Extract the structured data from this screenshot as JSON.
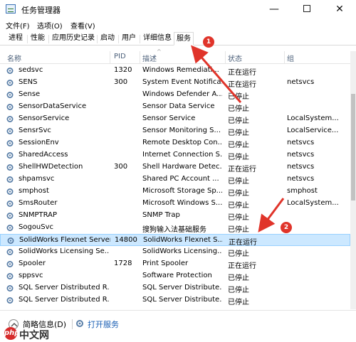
{
  "window": {
    "title": "任务管理器",
    "minimize": "—",
    "close": "✕"
  },
  "menu": [
    "文件(F)",
    "选项(O)",
    "查看(V)"
  ],
  "tabs": [
    "进程",
    "性能",
    "应用历史记录",
    "启动",
    "用户",
    "详细信息",
    "服务"
  ],
  "active_tab_index": 6,
  "columns": {
    "name": "名称",
    "pid": "PID",
    "desc": "描述",
    "status": "状态",
    "group": "组"
  },
  "services": [
    {
      "name": "sedsvc",
      "pid": "1320",
      "desc": "Windows Remediati...",
      "status": "正在运行",
      "group": ""
    },
    {
      "name": "SENS",
      "pid": "300",
      "desc": "System Event Notifica...",
      "status": "正在运行",
      "group": "netsvcs"
    },
    {
      "name": "Sense",
      "pid": "",
      "desc": "Windows Defender A...",
      "status": "已停止",
      "group": ""
    },
    {
      "name": "SensorDataService",
      "pid": "",
      "desc": "Sensor Data Service",
      "status": "已停止",
      "group": ""
    },
    {
      "name": "SensorService",
      "pid": "",
      "desc": "Sensor Service",
      "status": "已停止",
      "group": "LocalSystem..."
    },
    {
      "name": "SensrSvc",
      "pid": "",
      "desc": "Sensor Monitoring S...",
      "status": "已停止",
      "group": "LocalService..."
    },
    {
      "name": "SessionEnv",
      "pid": "",
      "desc": "Remote Desktop Con...",
      "status": "已停止",
      "group": "netsvcs"
    },
    {
      "name": "SharedAccess",
      "pid": "",
      "desc": "Internet Connection S...",
      "status": "已停止",
      "group": "netsvcs"
    },
    {
      "name": "ShellHWDetection",
      "pid": "300",
      "desc": "Shell Hardware Detec...",
      "status": "正在运行",
      "group": "netsvcs"
    },
    {
      "name": "shpamsvc",
      "pid": "",
      "desc": "Shared PC Account ...",
      "status": "已停止",
      "group": "netsvcs"
    },
    {
      "name": "smphost",
      "pid": "",
      "desc": "Microsoft Storage Sp...",
      "status": "已停止",
      "group": "smphost"
    },
    {
      "name": "SmsRouter",
      "pid": "",
      "desc": "Microsoft Windows S...",
      "status": "已停止",
      "group": "LocalSystem..."
    },
    {
      "name": "SNMPTRAP",
      "pid": "",
      "desc": "SNMP Trap",
      "status": "已停止",
      "group": ""
    },
    {
      "name": "SogouSvc",
      "pid": "",
      "desc": "搜狗输入法基础服务",
      "status": "已停止",
      "group": ""
    },
    {
      "name": "SolidWorks Flexnet Server",
      "pid": "14800",
      "desc": "SolidWorks Flexnet S...",
      "status": "正在运行",
      "group": ""
    },
    {
      "name": "SolidWorks Licensing Se...",
      "pid": "",
      "desc": "SolidWorks Licensing...",
      "status": "已停止",
      "group": ""
    },
    {
      "name": "Spooler",
      "pid": "1728",
      "desc": "Print Spooler",
      "status": "正在运行",
      "group": ""
    },
    {
      "name": "sppsvc",
      "pid": "",
      "desc": "Software Protection",
      "status": "已停止",
      "group": ""
    },
    {
      "name": "SQL Server Distributed R...",
      "pid": "",
      "desc": "SQL Server Distribute...",
      "status": "已停止",
      "group": ""
    },
    {
      "name": "SQL Server Distributed R...",
      "pid": "",
      "desc": "SQL Server Distribute...",
      "status": "已停止",
      "group": ""
    }
  ],
  "selected_row_index": 14,
  "footer": {
    "less_details": "简略信息(D)",
    "open_services": "打开服务"
  },
  "annotations": {
    "badge1": "1",
    "badge2": "2",
    "arrow_color": "#e0342a"
  },
  "watermark": {
    "logo": "php",
    "text": "中文网"
  }
}
